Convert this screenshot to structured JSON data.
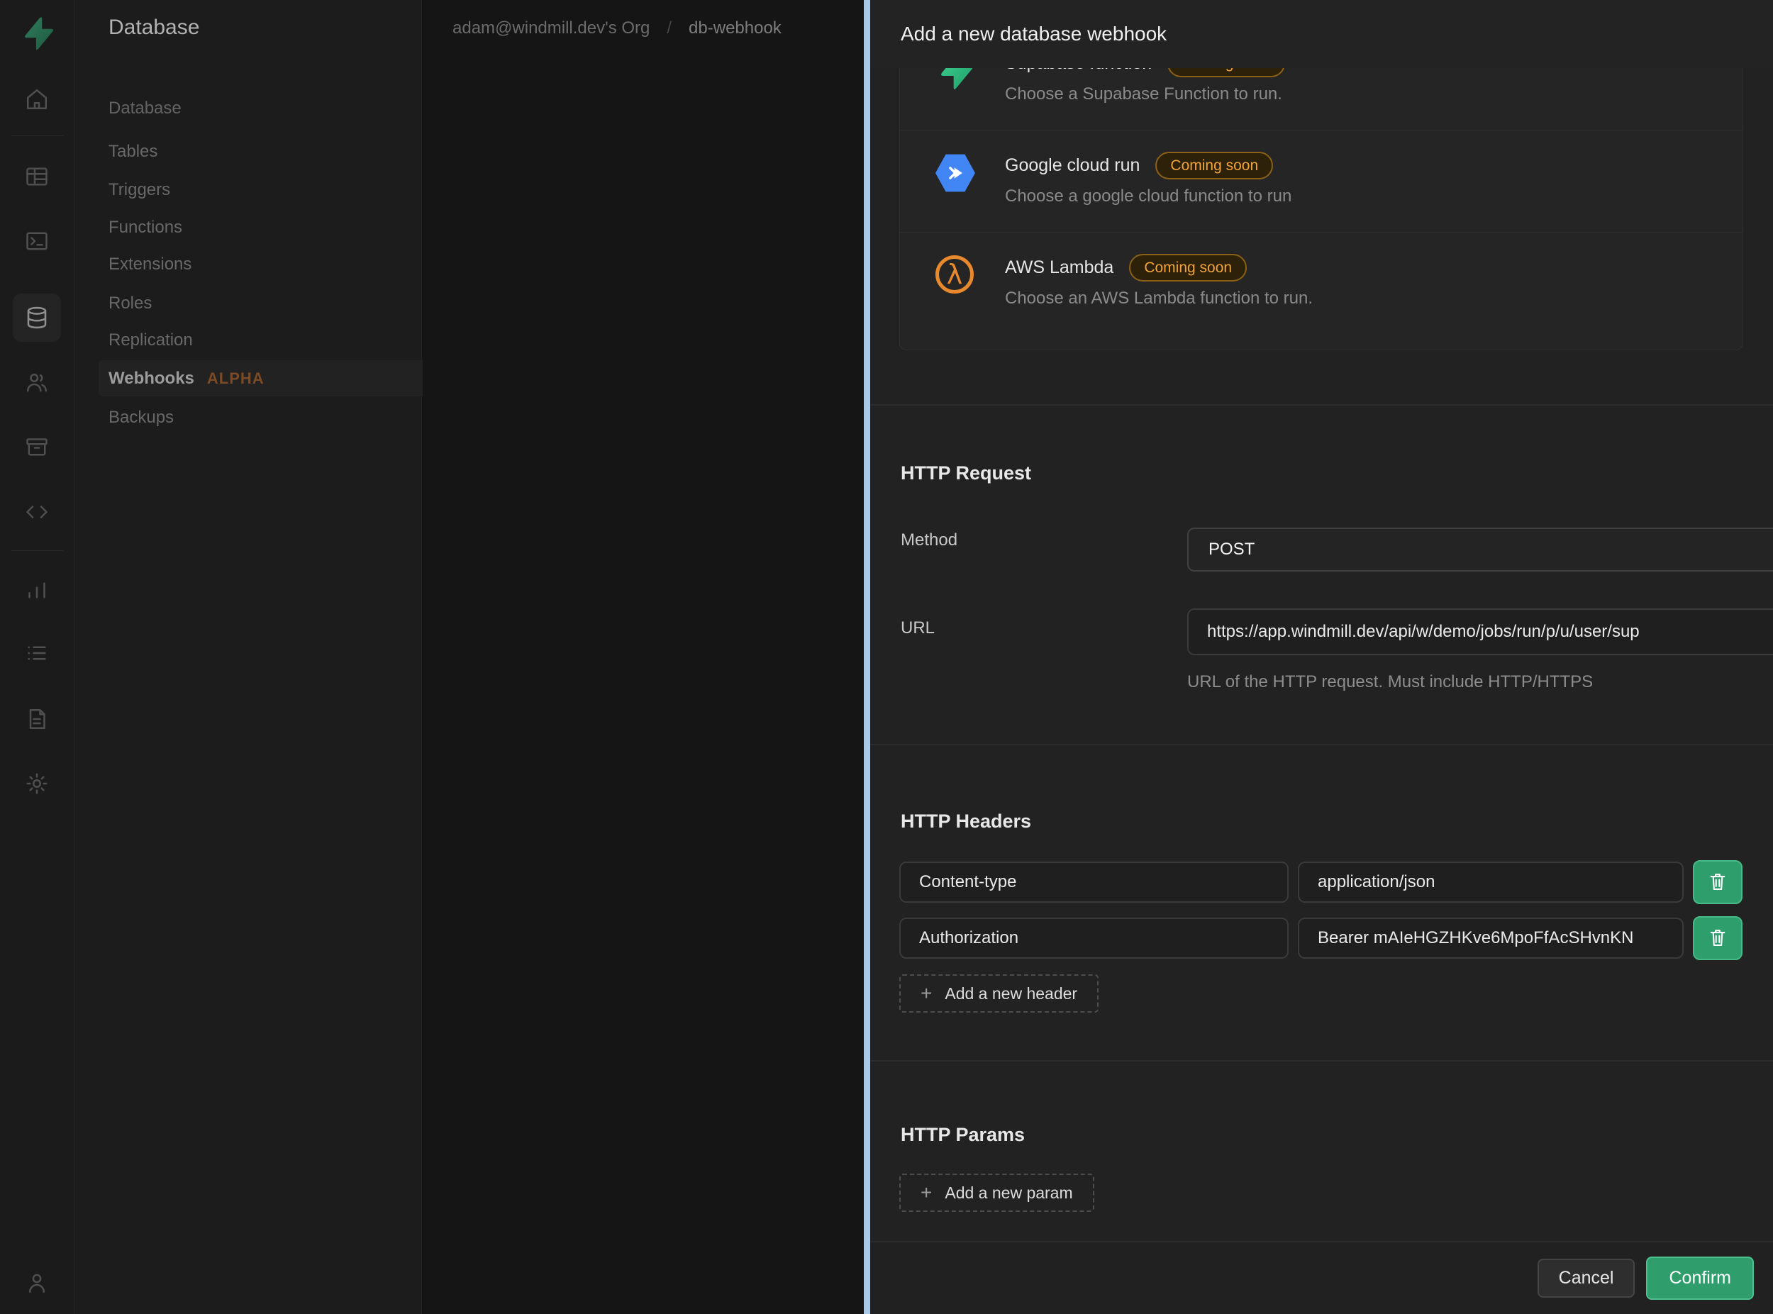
{
  "ui": {
    "plus": "+",
    "breadcrumb_separator": "/"
  },
  "sidebar": {
    "product_title": "Database",
    "rail_icons": [
      "supabase-logo-icon",
      "home-icon",
      "table-editor-icon",
      "sql-editor-icon",
      "database-icon",
      "auth-icon",
      "storage-icon",
      "api-icon",
      "reports-icon",
      "logs-icon",
      "docs-icon",
      "settings-icon",
      "account-icon"
    ],
    "active_rail_item": "database"
  },
  "menu": {
    "heading": "Database",
    "items": [
      "Tables",
      "Triggers",
      "Functions",
      "Extensions",
      "Roles",
      "Replication",
      "Webhooks",
      "Backups"
    ],
    "active_item": "Webhooks",
    "alpha_badge": "ALPHA"
  },
  "breadcrumb": {
    "org": "adam@windmill.dev's Org",
    "project": "db-webhook"
  },
  "panel": {
    "title": "Add a new database webhook",
    "options": [
      {
        "name": "Supabase function",
        "badge": "Coming soon",
        "description": "Choose a Supabase Function to run.",
        "icon": "supabase-bolt-icon"
      },
      {
        "name": "Google cloud run",
        "badge": "Coming soon",
        "description": "Choose a google cloud function to run",
        "icon": "google-cloud-run-icon"
      },
      {
        "name": "AWS Lambda",
        "badge": "Coming soon",
        "description": "Choose an AWS Lambda function to run.",
        "icon": "aws-lambda-icon"
      }
    ],
    "http_request": {
      "heading": "HTTP Request",
      "method_label": "Method",
      "method_value": "POST",
      "url_label": "URL",
      "url_value": "https://app.windmill.dev/api/w/demo/jobs/run/p/u/user/sup",
      "url_help": "URL of the HTTP request. Must include HTTP/HTTPS"
    },
    "http_headers": {
      "heading": "HTTP Headers",
      "rows": [
        {
          "name": "Content-type",
          "value": "application/json"
        },
        {
          "name": "Authorization",
          "value": "Bearer mAIeHGZHKve6MpoFfAcSHvnKN"
        }
      ],
      "add_label": "Add a new header"
    },
    "http_params": {
      "heading": "HTTP Params",
      "add_label": "Add a new param"
    },
    "footer": {
      "cancel_label": "Cancel",
      "confirm_label": "Confirm"
    }
  },
  "colors": {
    "brand_green": "#3ecf8e",
    "button_green": "#2f9e6c",
    "coming_soon_amber": "#f0a33c",
    "gcloud_blue": "#4285f4",
    "lambda_orange": "#e8892d",
    "panel_edge_blue": "#a8c9e8"
  }
}
